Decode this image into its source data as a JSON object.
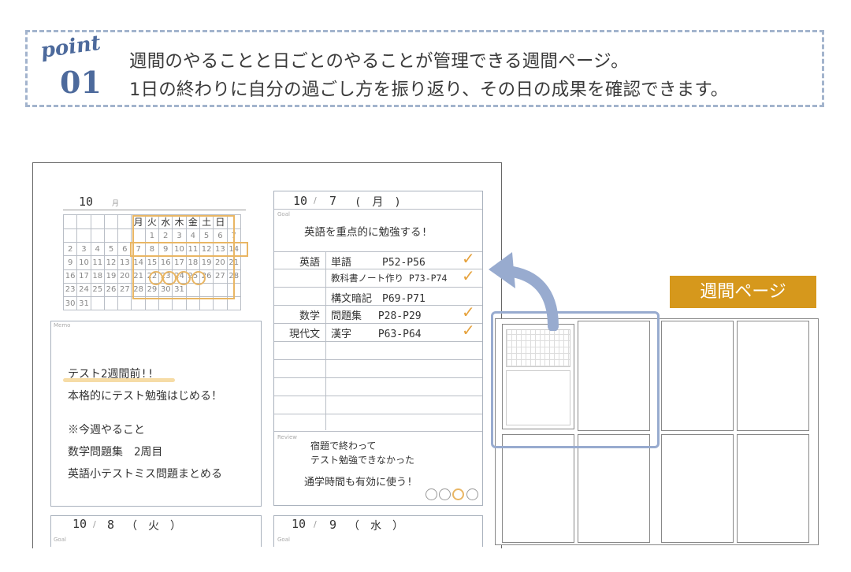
{
  "header": {
    "point_word": "point",
    "point_number": "01",
    "line1": "週間のやることと日ごとのやることが管理できる週間ページ。",
    "line2": "1日の終わりに自分の過ごし方を振り返り、その日の成果を確認できます。"
  },
  "planner": {
    "month": "10",
    "month_unit": "月",
    "calendar": {
      "weekdays": [
        "月",
        "火",
        "水",
        "木",
        "金",
        "土",
        "日"
      ],
      "rows": [
        [
          "",
          "",
          "",
          "",
          "",
          "",
          "",
          "",
          "1",
          "2",
          "3",
          "4",
          "5",
          "6",
          "7"
        ],
        [
          "2",
          "3",
          "4",
          "5",
          "6",
          "7",
          "8",
          "9",
          "10",
          "11",
          "12",
          "13",
          "14"
        ],
        [
          "9",
          "10",
          "11",
          "12",
          "13",
          "14",
          "15",
          "16",
          "17",
          "18",
          "19",
          "20",
          "21"
        ],
        [
          "16",
          "17",
          "18",
          "19",
          "20",
          "21",
          "22",
          "23",
          "24",
          "25",
          "26",
          "27",
          "28"
        ],
        [
          "23",
          "24",
          "25",
          "26",
          "27",
          "28",
          "29",
          "30",
          "31"
        ],
        [
          "30",
          "31"
        ]
      ]
    },
    "memo": {
      "label": "Memo",
      "lines": [
        "テスト2週間前!!",
        "本格的にテスト勉強はじめる！",
        "※今週やること",
        "数学問題集　2周目",
        "英語小テストミス問題まとめる"
      ]
    },
    "day": {
      "month": "10",
      "sep": "/",
      "date": "7",
      "weekday": "(　月　)",
      "goal_label": "Goal",
      "goal": "英語を重点的に勉強する!",
      "tasks": [
        {
          "subject": "英語",
          "text": "単語　　　P52-P56"
        },
        {
          "subject": "",
          "text": "教科書ノート作り P73-P74"
        },
        {
          "subject": "",
          "text": "構文暗記　P69-P71"
        },
        {
          "subject": "数学",
          "text": "問題集　 P28-P29"
        },
        {
          "subject": "現代文",
          "text": "漢字　　 P63-P64"
        }
      ],
      "check_mark": "✓",
      "review_label": "Review",
      "review": [
        "宿題で終わって",
        "テスト勉強できなかった",
        "通学時間も有効に使う!"
      ]
    },
    "next_days": [
      {
        "month": "10",
        "sep": "/",
        "date": "8",
        "weekday": "（　火　）",
        "goal_label": "Goal"
      },
      {
        "month": "10",
        "sep": "/",
        "date": "9",
        "weekday": "（　水　）",
        "goal_label": "Goal"
      }
    ]
  },
  "weekly_page_label": "週間ページ",
  "colors": {
    "accent": "#d6981c",
    "highlight": "#e9b664",
    "blue": "#4d6a9c"
  }
}
